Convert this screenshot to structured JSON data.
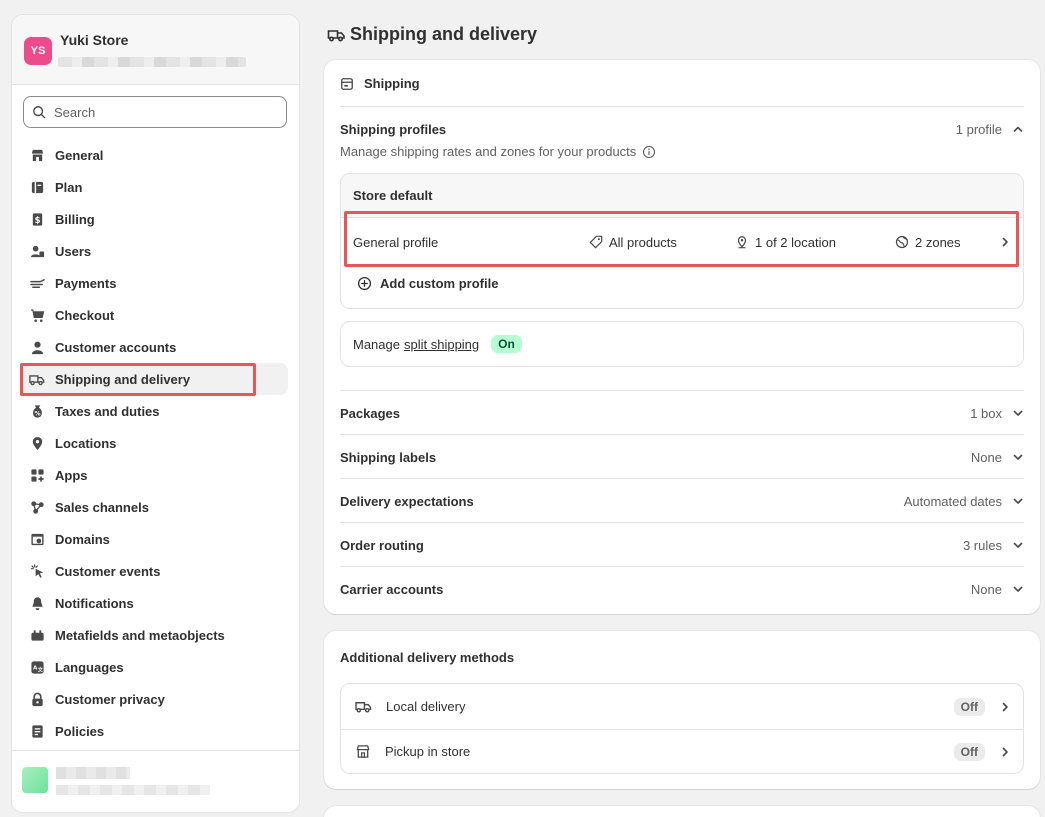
{
  "store": {
    "initials": "YS",
    "name": "Yuki Store"
  },
  "search": {
    "placeholder": "Search"
  },
  "nav": [
    {
      "label": "General",
      "icon": "store-icon"
    },
    {
      "label": "Plan",
      "icon": "plan-icon"
    },
    {
      "label": "Billing",
      "icon": "billing-icon"
    },
    {
      "label": "Users",
      "icon": "users-icon"
    },
    {
      "label": "Payments",
      "icon": "payments-icon"
    },
    {
      "label": "Checkout",
      "icon": "cart-icon"
    },
    {
      "label": "Customer accounts",
      "icon": "person-icon"
    },
    {
      "label": "Shipping and delivery",
      "icon": "truck-icon",
      "active": true
    },
    {
      "label": "Taxes and duties",
      "icon": "tax-icon"
    },
    {
      "label": "Locations",
      "icon": "location-icon"
    },
    {
      "label": "Apps",
      "icon": "apps-icon"
    },
    {
      "label": "Sales channels",
      "icon": "channels-icon"
    },
    {
      "label": "Domains",
      "icon": "domains-icon"
    },
    {
      "label": "Customer events",
      "icon": "cursor-icon"
    },
    {
      "label": "Notifications",
      "icon": "bell-icon"
    },
    {
      "label": "Metafields and metaobjects",
      "icon": "metafields-icon"
    },
    {
      "label": "Languages",
      "icon": "languages-icon"
    },
    {
      "label": "Customer privacy",
      "icon": "lock-icon"
    },
    {
      "label": "Policies",
      "icon": "policies-icon"
    }
  ],
  "page": {
    "title": "Shipping and delivery"
  },
  "shipping": {
    "header": "Shipping",
    "profiles_label": "Shipping profiles",
    "profiles_count": "1 profile",
    "profiles_desc": "Manage shipping rates and zones for your products",
    "store_default": "Store default",
    "general_profile": {
      "name": "General profile",
      "products": "All products",
      "locations": "1 of 2 location",
      "zones": "2 zones"
    },
    "add_custom": "Add custom profile",
    "split": {
      "prefix": "Manage",
      "link": "split shipping",
      "status": "On"
    },
    "rows": [
      {
        "label": "Packages",
        "value": "1 box"
      },
      {
        "label": "Shipping labels",
        "value": "None"
      },
      {
        "label": "Delivery expectations",
        "value": "Automated dates"
      },
      {
        "label": "Order routing",
        "value": "3 rules"
      },
      {
        "label": "Carrier accounts",
        "value": "None"
      }
    ]
  },
  "additional": {
    "title": "Additional delivery methods",
    "methods": [
      {
        "label": "Local delivery",
        "status": "Off"
      },
      {
        "label": "Pickup in store",
        "status": "Off"
      }
    ]
  },
  "colors": {
    "accent_avatar": "#ec4c8b",
    "highlight": "#e85757",
    "badge_on": "#b4fed2",
    "badge_off": "#ebebeb"
  }
}
